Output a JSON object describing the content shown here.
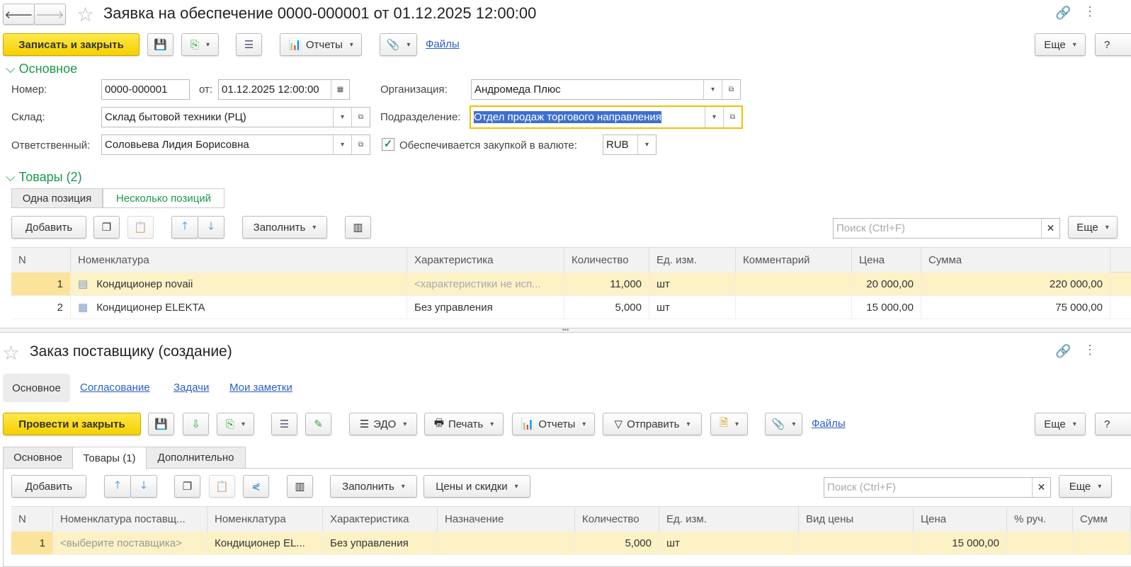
{
  "top": {
    "title": "Заявка на обеспечение 0000-000001 от 01.12.2025 12:00:00",
    "toolbar": {
      "save_close": "Записать и закрыть",
      "reports": "Отчеты",
      "files": "Файлы",
      "more": "Еще",
      "help": "?"
    },
    "section_main": "Основное",
    "fields": {
      "number_label": "Номер:",
      "number": "0000-000001",
      "date_label": "от:",
      "date": "01.12.2025 12:00:00",
      "org_label": "Организация:",
      "org": "Андромеда Плюс",
      "warehouse_label": "Склад:",
      "warehouse": "Склад бытовой техники (РЦ)",
      "dept_label": "Подразделение:",
      "dept": "Отдел продаж торгового направления",
      "resp_label": "Ответственный:",
      "resp": "Соловьева Лидия Борисовна",
      "purchase_label": "Обеспечивается закупкой в валюте:",
      "purchase_checked": true,
      "currency": "RUB"
    },
    "section_goods": "Товары (2)",
    "mode_tabs": [
      "Одна позиция",
      "Несколько позиций"
    ],
    "goods_toolbar": {
      "add": "Добавить",
      "fill": "Заполнить",
      "search_placeholder": "Поиск (Ctrl+F)",
      "more": "Еще"
    },
    "table": {
      "columns": [
        "N",
        "Номенклатура",
        "Характеристика",
        "Количество",
        "Ед. изм.",
        "Комментарий",
        "Цена",
        "Сумма"
      ],
      "rows": [
        {
          "n": "1",
          "item": "Кондиционер novaii",
          "char": "<характеристики не исп...",
          "qty": "11,000",
          "unit": "шт",
          "comment": "",
          "price": "20 000,00",
          "sum": "220 000,00"
        },
        {
          "n": "2",
          "item": "Кондиционер ELEKTA",
          "char": "Без управления",
          "qty": "5,000",
          "unit": "шт",
          "comment": "",
          "price": "15 000,00",
          "sum": "75 000,00"
        }
      ]
    }
  },
  "bottom": {
    "title": "Заказ поставщику (создание)",
    "nav": [
      "Основное",
      "Согласование",
      "Задачи",
      "Мои заметки"
    ],
    "toolbar": {
      "post_close": "Провести и закрыть",
      "edo": "ЭДО",
      "print": "Печать",
      "reports": "Отчеты",
      "send": "Отправить",
      "files": "Файлы",
      "more": "Еще",
      "help": "?"
    },
    "tabs": [
      "Основное",
      "Товары (1)",
      "Дополнительно"
    ],
    "goods_toolbar": {
      "add": "Добавить",
      "fill": "Заполнить",
      "prices": "Цены и скидки",
      "search_placeholder": "Поиск (Ctrl+F)",
      "more": "Еще"
    },
    "table": {
      "columns": [
        "N",
        "Номенклатура поставщ...",
        "Номенклатура",
        "Характеристика",
        "Назначение",
        "Количество",
        "Ед. изм.",
        "Вид цены",
        "Цена",
        "% руч.",
        "Сумм"
      ],
      "rows": [
        {
          "n": "1",
          "supplier_item": "<выберите поставщика>",
          "item": "Кондиционер EL...",
          "char": "Без управления",
          "purpose": "",
          "qty": "5,000",
          "unit": "шт",
          "price_type": "",
          "price": "15 000,00",
          "manual": "",
          "sum": ""
        }
      ]
    }
  },
  "colors": {
    "accent_green": "#1a9a4a",
    "primary_yellow": "#f5d000",
    "row_selected": "#fdf1c6",
    "link": "#2a5ecb"
  }
}
